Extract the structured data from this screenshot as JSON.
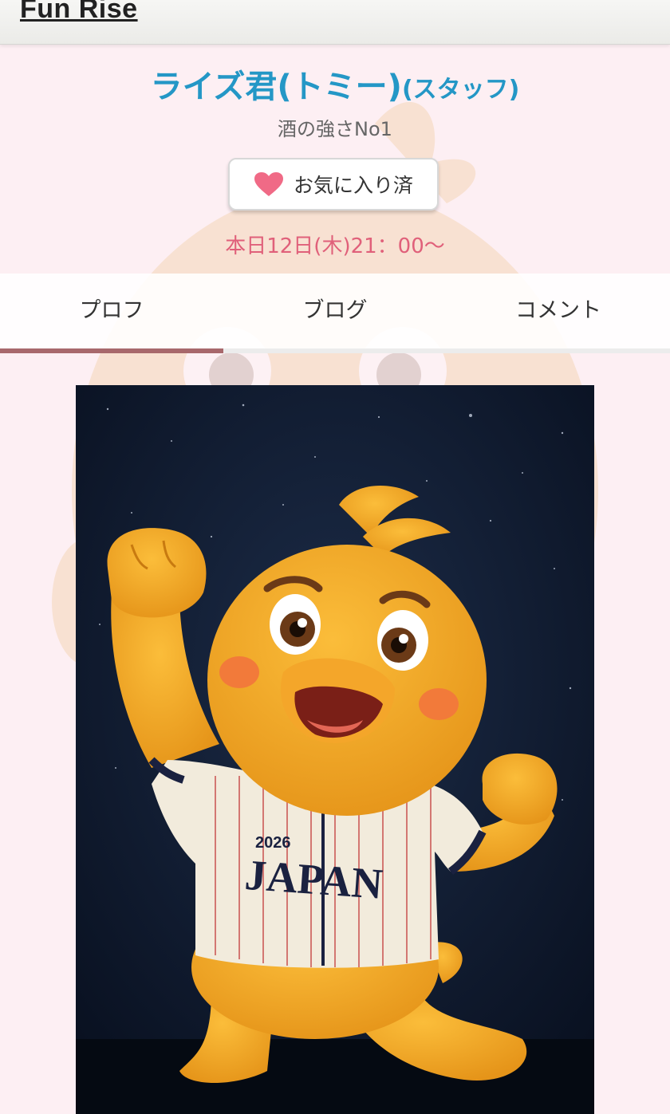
{
  "header": {
    "site_title": "Fun Rise"
  },
  "profile": {
    "name": "ライズ君(トミー)",
    "role": "(スタッフ)",
    "tagline": "酒の強さNo1",
    "favorite_label": "お気に入り済",
    "schedule": "本日12日(木)21：00〜"
  },
  "tabs": [
    {
      "label": "プロフ",
      "active": true
    },
    {
      "label": "ブログ",
      "active": false
    },
    {
      "label": "コメント",
      "active": false
    }
  ],
  "photo": {
    "jersey_year": "2026",
    "jersey_text": "JAPAN"
  },
  "colors": {
    "accent_blue": "#2497c6",
    "schedule_pink": "#e0607a",
    "heart": "#f06a86",
    "tab_active": "#a8686c"
  }
}
